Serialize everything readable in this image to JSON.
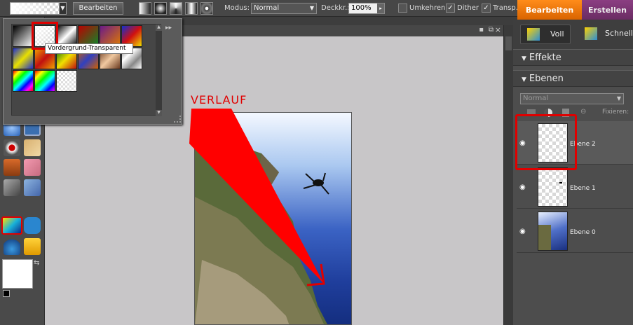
{
  "optionsbar": {
    "edit_label": "Bearbeiten",
    "mode_label": "Modus:",
    "mode_value": "Normal",
    "opacity_label": "Deckkr.:",
    "opacity_value": "100%",
    "reverse_label": "Umkehren",
    "dither_label": "Dither",
    "transp_label": "Transp.",
    "reverse_checked": false,
    "dither_checked": true,
    "transp_checked": true
  },
  "tabs": {
    "edit": "Bearbeiten",
    "create": "Erstellen"
  },
  "annotation": {
    "text": "VERLAUF"
  },
  "palette": {
    "tooltip": "Vordergrund-Transparent",
    "expand_glyph": "▸▸"
  },
  "right_panel": {
    "mode_full": "Voll",
    "mode_quick": "Schnell",
    "effects_title": "Effekte",
    "layers_title": "Ebenen",
    "blend_mode": "Normal",
    "fix_label": "Fixieren:",
    "layers": [
      {
        "name": "Ebene 2"
      },
      {
        "name": "Ebene 1"
      },
      {
        "name": "Ebene 0"
      }
    ]
  },
  "colors": {
    "accent_orange": "#e8760a",
    "tab_purple": "#7a3572",
    "highlight_red": "#e00000"
  }
}
